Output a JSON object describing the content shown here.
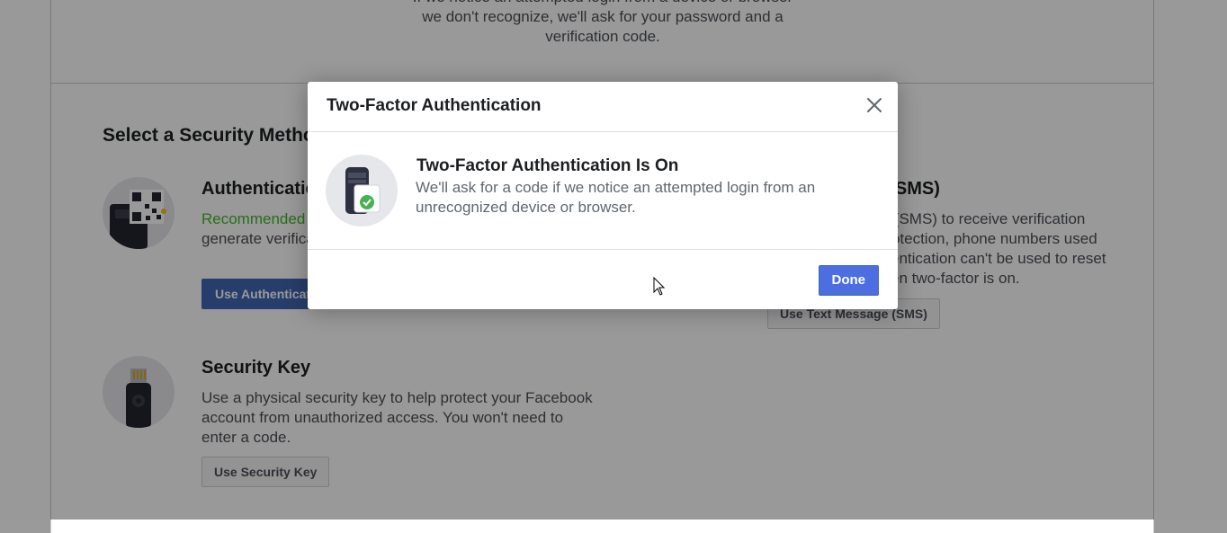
{
  "background": {
    "top_card": {
      "description": "If we notice an attempted login from a device or browser we don't recognize, we'll ask for your password and a verification code."
    },
    "section_title": "Select a Security Method",
    "methods": {
      "authenticator": {
        "title": "Authentication App",
        "recommended": "Recommended",
        "description": "Use an app like Google Authenticator or Duo Mobile to generate verification codes for more protection.",
        "button": "Use Authentication App",
        "icon": "qr-phone-icon"
      },
      "sms": {
        "title": "Text Message (SMS)",
        "description": "Use text message (SMS) to receive verification codes. For your protection, phone numbers used for two-factor authentication can't be used to reset your password when two-factor is on.",
        "button": "Use Text Message (SMS)"
      },
      "security_key": {
        "title": "Security Key",
        "description": "Use a physical security key to help protect your Facebook account from unauthorized access. You won't need to enter a code.",
        "button": "Use Security Key",
        "icon": "usb-key-icon"
      }
    }
  },
  "dialog": {
    "title": "Two-Factor Authentication",
    "close_icon": "close-icon",
    "status_icon": "phone-check-icon",
    "status_title": "Two-Factor Authentication Is On",
    "status_text": "We'll ask for a code if we notice an attempted login from an unrecognized device or browser.",
    "done_label": "Done"
  },
  "colors": {
    "primary": "#4c6ee0",
    "recommended": "#42b72a",
    "check_green": "#44b34d"
  }
}
